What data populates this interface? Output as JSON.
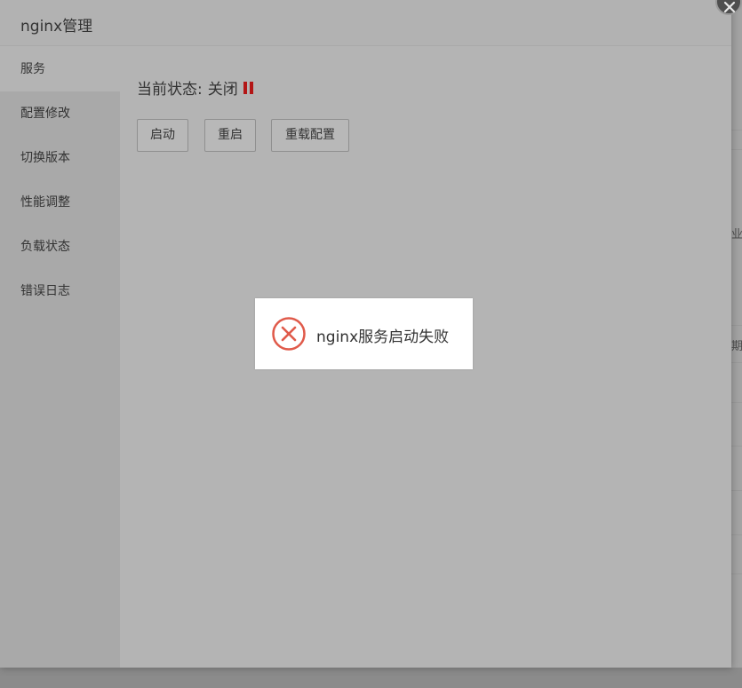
{
  "window": {
    "title": "nginx管理",
    "close_symbol": "×"
  },
  "sidebar": {
    "items": [
      {
        "label": "服务",
        "active": true
      },
      {
        "label": "配置修改"
      },
      {
        "label": "切换版本"
      },
      {
        "label": "性能调整"
      },
      {
        "label": "负载状态"
      },
      {
        "label": "错误日志"
      }
    ]
  },
  "service": {
    "status_label": "当前状态:",
    "status_value": "关闭",
    "status_icon": "pause-icon",
    "status_color": "#b31616",
    "buttons": {
      "start": "启动",
      "restart": "重启",
      "reload": "重载配置"
    }
  },
  "toast": {
    "icon": "error-circle-icon",
    "icon_color": "#e05a4a",
    "message": "nginx服务启动失败"
  },
  "background": {
    "partial_text_1": "业",
    "partial_text_2": "期"
  }
}
